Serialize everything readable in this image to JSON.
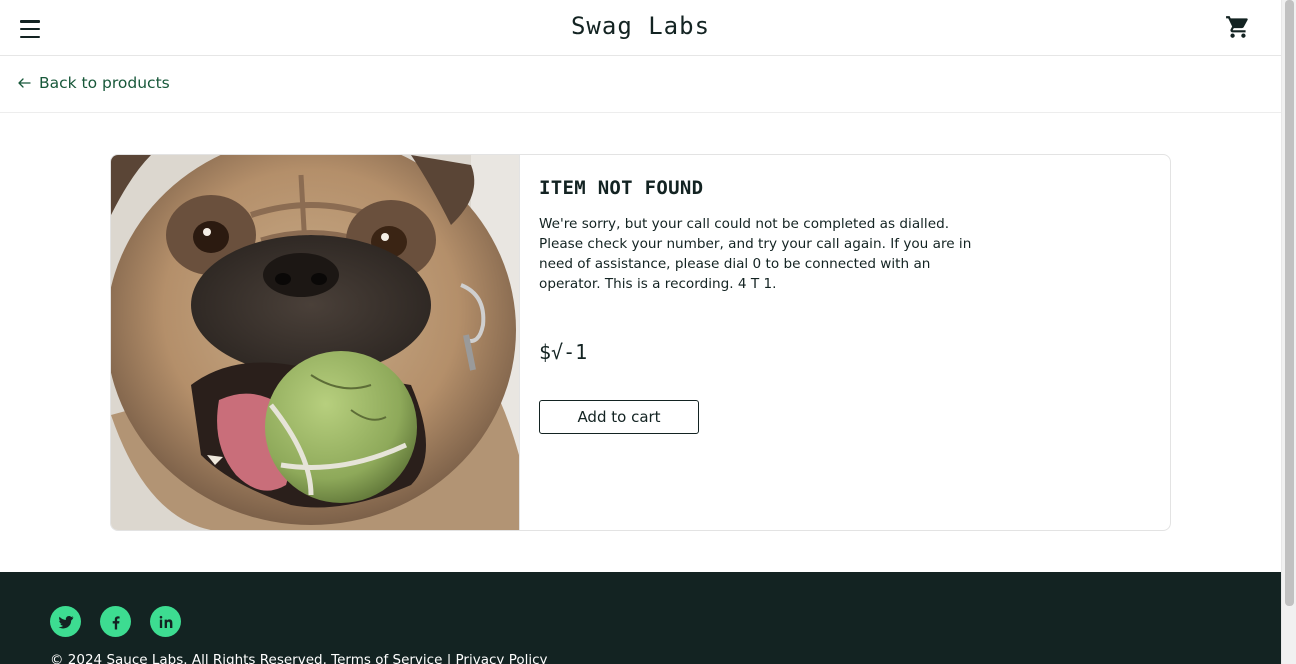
{
  "header": {
    "title": "Swag Labs",
    "menu_icon": "hamburger-menu-icon",
    "cart_icon": "shopping-cart-icon"
  },
  "secondary_header": {
    "back_label": "Back to products",
    "back_icon": "arrow-left-icon"
  },
  "item": {
    "title": "ITEM NOT FOUND",
    "description": "We're sorry, but your call could not be completed as dialled. Please check your number, and try your call again. If you are in need of assistance, please dial 0 to be connected with an operator. This is a recording. 4 T 1.",
    "price": "$√-1",
    "add_to_cart_label": "Add to cart",
    "image": "pug-with-tennis-ball"
  },
  "footer": {
    "social": [
      {
        "name": "twitter",
        "icon": "twitter-icon"
      },
      {
        "name": "facebook",
        "icon": "facebook-icon"
      },
      {
        "name": "linkedin",
        "icon": "linkedin-icon"
      }
    ],
    "copyright": "© 2024 Sauce Labs. All Rights Reserved. Terms of Service | Privacy Policy"
  },
  "colors": {
    "brand_text": "#132322",
    "link_green": "#18583a",
    "footer_bg": "#132322",
    "social_green": "#3ddc91"
  }
}
